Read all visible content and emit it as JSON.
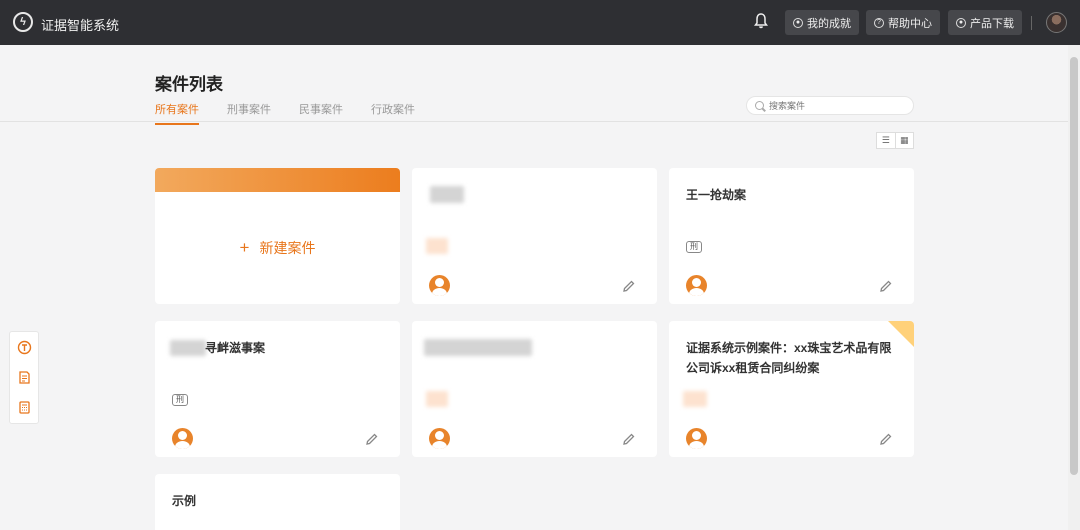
{
  "header": {
    "app_title": "证据智能系统",
    "logo_icon": "lightning-circle-icon",
    "buttons": [
      {
        "label": "我的成就",
        "icon": "target-icon"
      },
      {
        "label": "帮助中心",
        "icon": "help-icon"
      },
      {
        "label": "产品下载",
        "icon": "download-icon"
      }
    ]
  },
  "page": {
    "title": "案件列表",
    "tabs": [
      "所有案件",
      "刑事案件",
      "民事案件",
      "行政案件"
    ],
    "active_tab": 0,
    "search_placeholder": "搜索案件"
  },
  "cards": {
    "new_card": {
      "label": "新建案件",
      "plus": "+"
    },
    "robbery": {
      "title": "王一抢劫案",
      "tag": "刑"
    },
    "quarrel": {
      "title": "寻衅滋事案",
      "tag": "刑"
    },
    "sample_case": {
      "title": "证据系统示例案件：xx珠宝艺术品有限公司诉xx租赁合同纠纷案"
    },
    "example": {
      "title": "示例"
    }
  },
  "colors": {
    "accent": "#e8761c",
    "topbar": "#2e2f33",
    "badge": "#ffd17a"
  }
}
